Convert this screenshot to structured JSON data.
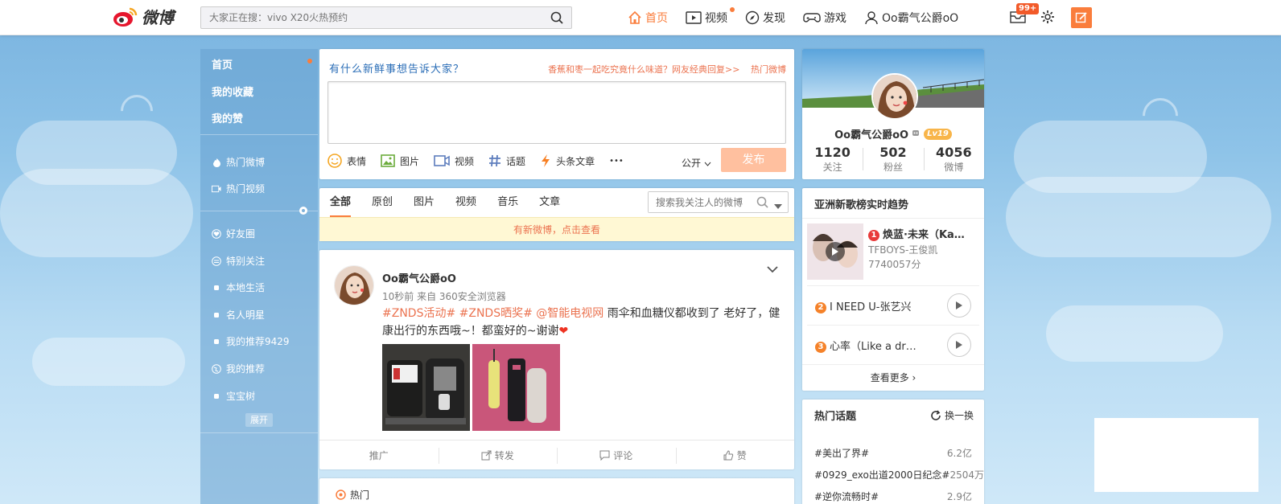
{
  "brand": {
    "logo_text": "微博"
  },
  "search": {
    "placeholder": "大家正在搜：vivo X20火热预约"
  },
  "nav": [
    {
      "label": "首页",
      "icon": "home-icon"
    },
    {
      "label": "视频",
      "icon": "video-icon"
    },
    {
      "label": "发现",
      "icon": "discover-icon"
    },
    {
      "label": "游戏",
      "icon": "game-icon"
    },
    {
      "label": "Oo霸气公爵oO",
      "icon": "user-icon"
    }
  ],
  "top_right": {
    "mail_badge": "99+"
  },
  "left_nav": {
    "primary": [
      "首页",
      "我的收藏",
      "我的赞"
    ],
    "secondary": [
      "热门微博",
      "热门视频"
    ],
    "groups": [
      "好友圈",
      "特别关注",
      "本地生活",
      "名人明星",
      "我的推荐9429",
      "我的推荐",
      "宝宝树"
    ],
    "expand": "展开"
  },
  "publisher": {
    "prompt": "有什么新鲜事想告诉大家？",
    "hot_link": "香蕉和枣一起吃究竟什么味道？网友经典回复>>",
    "hot_label": "热门微博",
    "tools": [
      "表情",
      "图片",
      "视频",
      "话题",
      "头条文章"
    ],
    "more": "•••",
    "visibility": "公开",
    "submit": "发布"
  },
  "feed": {
    "tabs": [
      "全部",
      "原创",
      "图片",
      "视频",
      "音乐",
      "文章"
    ],
    "search_placeholder": "搜索我关注人的微博",
    "new_notice": "有新微博，点击查看"
  },
  "post": {
    "author": "Oo霸气公爵oO",
    "meta": "10秒前 来自 360安全浏览器",
    "tags": "#ZNDS活动# #ZNDS晒奖# @智能电视网",
    "text": " 雨伞和血糖仪都收到了 老好了，健康出行的东西哦~！都蛮好的~谢谢",
    "actions": [
      "推广",
      "转发",
      "评论",
      "赞"
    ]
  },
  "hot_section": {
    "label": "热门"
  },
  "profile": {
    "name": "Oo霸气公爵oO",
    "level": "Lv19",
    "stats": [
      {
        "num": "1120",
        "label": "关注"
      },
      {
        "num": "502",
        "label": "粉丝"
      },
      {
        "num": "4056",
        "label": "微博"
      }
    ]
  },
  "music": {
    "title": "亚洲新歌榜实时趋势",
    "top": {
      "rank": "1",
      "title": "焕蓝·未来（Ka…",
      "artist": "TFBOYS-王俊凯",
      "score": "7740057分"
    },
    "rows": [
      {
        "rank": "2",
        "title": "I NEED U-张艺兴"
      },
      {
        "rank": "3",
        "title": "心率（Like a dr…"
      }
    ],
    "see_more": "查看更多 ›"
  },
  "topics": {
    "title": "热门话题",
    "refresh": "换一换",
    "items": [
      {
        "name": "#美出了界#",
        "count": "6.2亿"
      },
      {
        "name": "#0929_exo出道2000日纪念#",
        "count": "2504万"
      },
      {
        "name": "#逆你流畅时#",
        "count": "2.9亿"
      }
    ]
  },
  "colors": {
    "accent": "#fa7d3c",
    "link": "#eb7350",
    "bg": "#8ec3e8"
  }
}
